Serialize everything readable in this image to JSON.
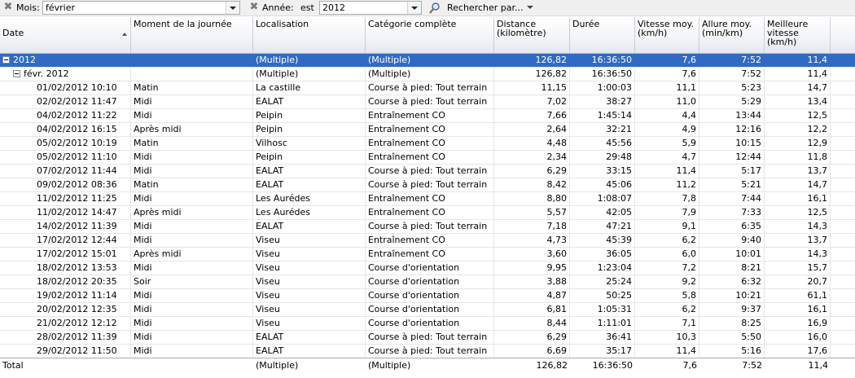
{
  "filter": {
    "month_label": "Mois:",
    "month_value": "février",
    "year_label": "Année:",
    "year_op": "est",
    "year_value": "2012",
    "search_label": "Rechercher par..."
  },
  "columns": [
    "Date",
    "Moment de la journée",
    "Localisation",
    "Catégorie complète",
    "Distance\n(kilomètre)",
    "Durée",
    "Vitesse moy.\n(km/h)",
    "Allure moy.\n(min/km)",
    "Meilleure\nvitesse\n(km/h)"
  ],
  "year_group": {
    "label": "2012",
    "location": "(Multiple)",
    "category": "(Multiple)",
    "distance": "126,82",
    "duration": "16:36:50",
    "speed": "7,6",
    "pace": "7:52",
    "best": "11,4"
  },
  "month_group": {
    "label": "févr. 2012",
    "location": "(Multiple)",
    "category": "(Multiple)",
    "distance": "126,82",
    "duration": "16:36:50",
    "speed": "7,6",
    "pace": "7:52",
    "best": "11,4"
  },
  "rows": [
    [
      "01/02/2012 10:10",
      "Matin",
      "La castille",
      "Course à pied: Tout terrain",
      "11,15",
      "1:00:03",
      "11,1",
      "5:23",
      "14,7"
    ],
    [
      "02/02/2012 11:47",
      "Midi",
      "EALAT",
      "Course à pied: Tout terrain",
      "7,02",
      "38:27",
      "11,0",
      "5:29",
      "13,4"
    ],
    [
      "04/02/2012 11:22",
      "Midi",
      "Peipin",
      "Entraînement CO",
      "7,66",
      "1:45:14",
      "4,4",
      "13:44",
      "12,5"
    ],
    [
      "04/02/2012 16:15",
      "Après midi",
      "Peipin",
      "Entraînement CO",
      "2,64",
      "32:21",
      "4,9",
      "12:16",
      "12,2"
    ],
    [
      "05/02/2012 10:19",
      "Matin",
      "Vilhosc",
      "Entraînement CO",
      "4,48",
      "45:56",
      "5,9",
      "10:15",
      "12,9"
    ],
    [
      "05/02/2012 11:10",
      "Midi",
      "Peipin",
      "Entraînement CO",
      "2,34",
      "29:48",
      "4,7",
      "12:44",
      "11,8"
    ],
    [
      "07/02/2012 11:44",
      "Midi",
      "EALAT",
      "Course à pied: Tout terrain",
      "6,29",
      "33:15",
      "11,4",
      "5:17",
      "13,7"
    ],
    [
      "09/02/2012 08:36",
      "Matin",
      "EALAT",
      "Course à pied: Tout terrain",
      "8,42",
      "45:06",
      "11,2",
      "5:21",
      "14,7"
    ],
    [
      "11/02/2012 11:25",
      "Midi",
      "Les Aurédes",
      "Entraînement CO",
      "8,80",
      "1:08:07",
      "7,8",
      "7:44",
      "16,1"
    ],
    [
      "11/02/2012 14:47",
      "Après midi",
      "Les Aurédes",
      "Entraînement CO",
      "5,57",
      "42:05",
      "7,9",
      "7:33",
      "12,5"
    ],
    [
      "14/02/2012 11:39",
      "Midi",
      "EALAT",
      "Course à pied: Tout terrain",
      "7,18",
      "47:21",
      "9,1",
      "6:35",
      "14,3"
    ],
    [
      "17/02/2012 12:44",
      "Midi",
      "Viseu",
      "Entraînement CO",
      "4,73",
      "45:39",
      "6,2",
      "9:40",
      "13,7"
    ],
    [
      "17/02/2012 15:01",
      "Après midi",
      "Viseu",
      "Entraînement CO",
      "3,60",
      "36:05",
      "6,0",
      "10:01",
      "14,3"
    ],
    [
      "18/02/2012 13:53",
      "Midi",
      "Viseu",
      "Course d'orientation",
      "9,95",
      "1:23:04",
      "7,2",
      "8:21",
      "15,7"
    ],
    [
      "18/02/2012 20:35",
      "Soir",
      "Viseu",
      "Course d'orientation",
      "3,88",
      "25:24",
      "9,2",
      "6:32",
      "20,7"
    ],
    [
      "19/02/2012 11:14",
      "Midi",
      "Viseu",
      "Course d'orientation",
      "4,87",
      "50:25",
      "5,8",
      "10:21",
      "61,1"
    ],
    [
      "20/02/2012 12:35",
      "Midi",
      "Viseu",
      "Course d'orientation",
      "6,81",
      "1:05:31",
      "6,2",
      "9:37",
      "16,1"
    ],
    [
      "21/02/2012 12:12",
      "Midi",
      "Viseu",
      "Course d'orientation",
      "8,44",
      "1:11:01",
      "7,1",
      "8:25",
      "16,9"
    ],
    [
      "28/02/2012 11:39",
      "Midi",
      "EALAT",
      "Course à pied: Tout terrain",
      "6,29",
      "36:41",
      "10,3",
      "5:50",
      "16,0"
    ],
    [
      "29/02/2012 11:50",
      "Midi",
      "EALAT",
      "Course à pied: Tout terrain",
      "6,69",
      "35:17",
      "11,4",
      "5:16",
      "17,6"
    ]
  ],
  "total": {
    "label": "Total",
    "location": "(Multiple)",
    "category": "(Multiple)",
    "distance": "126,82",
    "duration": "16:36:50",
    "speed": "7,6",
    "pace": "7:52",
    "best": "11,4"
  },
  "colors": {
    "selection": "#316ac5",
    "header_gradient_top": "#ffffff",
    "header_gradient_bottom": "#e4e8ee"
  }
}
